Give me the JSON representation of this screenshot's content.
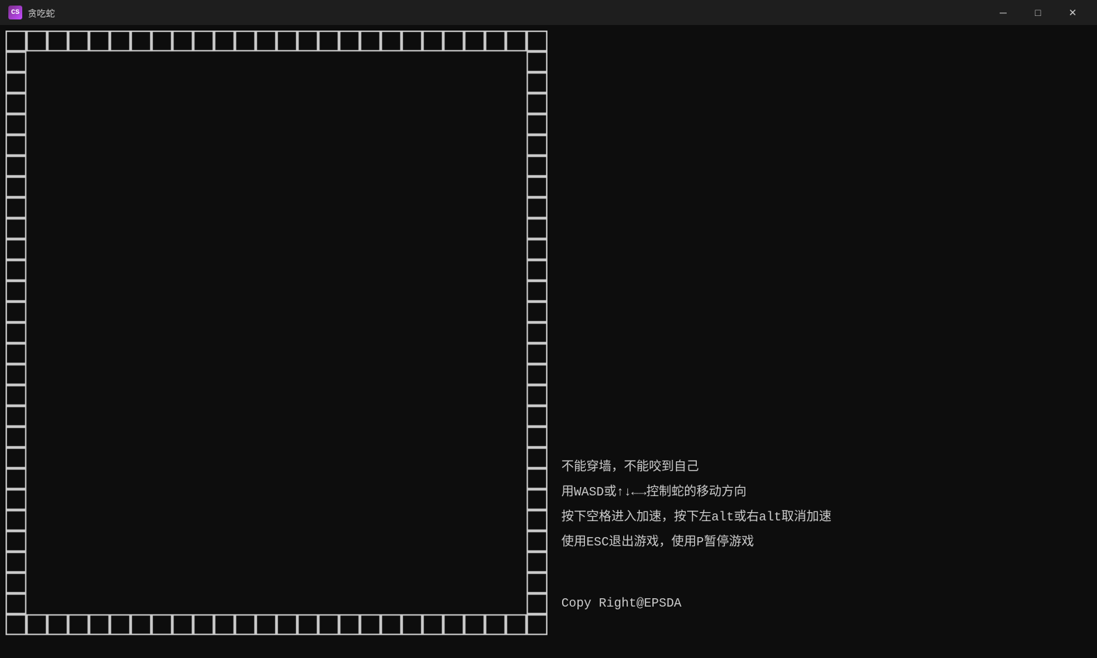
{
  "window": {
    "title": "贪吃蛇",
    "icon_label": "CS"
  },
  "titlebar": {
    "minimize_label": "─",
    "maximize_label": "□",
    "close_label": "✕"
  },
  "instructions": {
    "line1": "不能穿墙，不能咬到自己",
    "line2": "用WASD或↑↓←→控制蛇的移动方向",
    "line3": "按下空格进入加速，按下左alt或右alt取消加速",
    "line4": "使用ESC退出游戏，使用P暂停游戏"
  },
  "copyright": {
    "text": "Copy Right@EPSDA"
  },
  "colors": {
    "background": "#0d0d0d",
    "border_cell": "#cccccc",
    "text": "#cccccc",
    "titlebar_bg": "#1e1e1e",
    "accent": "#7b2d8b"
  }
}
